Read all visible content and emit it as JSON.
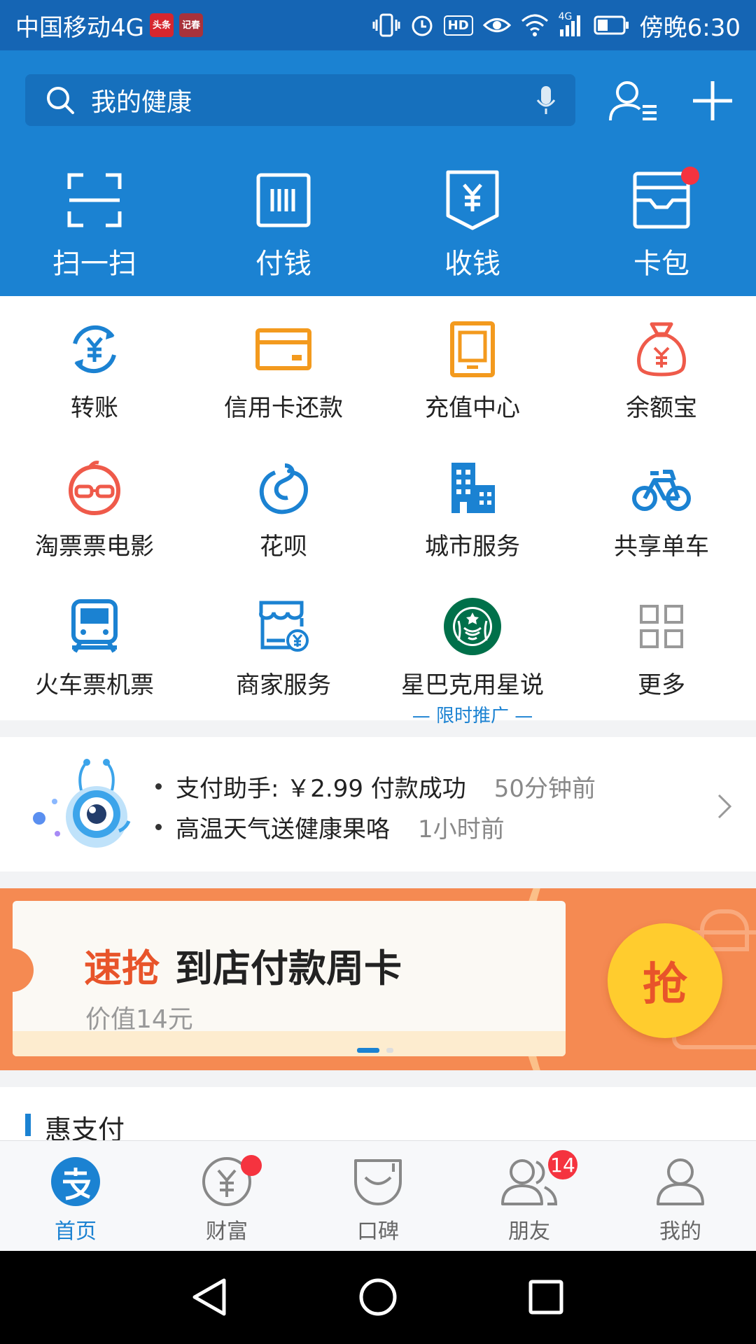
{
  "status_bar": {
    "carrier": "中国移动4G",
    "badge1": "头条",
    "badge2": "记春",
    "hd": "HD",
    "network": "4G",
    "time": "傍晚6:30"
  },
  "header": {
    "search_placeholder": "我的健康",
    "quick_actions": [
      {
        "label": "扫一扫",
        "icon": "scan-icon"
      },
      {
        "label": "付钱",
        "icon": "pay-barcode-icon"
      },
      {
        "label": "收钱",
        "icon": "receive-money-icon"
      },
      {
        "label": "卡包",
        "icon": "card-wallet-icon"
      }
    ]
  },
  "apps": [
    {
      "label": "转账",
      "icon": "transfer-icon",
      "color": "#1b82d2"
    },
    {
      "label": "信用卡还款",
      "icon": "credit-card-icon",
      "color": "#f39a1e"
    },
    {
      "label": "充值中心",
      "icon": "phone-recharge-icon",
      "color": "#f39a1e"
    },
    {
      "label": "余额宝",
      "icon": "money-bag-icon",
      "color": "#ef5a4a"
    },
    {
      "label": "淘票票电影",
      "icon": "movie-mascot-icon",
      "color": "#ef5a4a"
    },
    {
      "label": "花呗",
      "icon": "huabei-icon",
      "color": "#1b82d2"
    },
    {
      "label": "城市服务",
      "icon": "city-building-icon",
      "color": "#1b82d2"
    },
    {
      "label": "共享单车",
      "icon": "bicycle-icon",
      "color": "#1b82d2"
    },
    {
      "label": "火车票机票",
      "icon": "train-icon",
      "color": "#1b82d2"
    },
    {
      "label": "商家服务",
      "icon": "shop-icon",
      "color": "#1b82d2"
    },
    {
      "label": "星巴克用星说",
      "icon": "starbucks-icon",
      "color": "#00704a",
      "sub": "— 限时推广 —"
    },
    {
      "label": "更多",
      "icon": "more-grid-icon",
      "color": "#999999"
    }
  ],
  "notice": {
    "line1_text": "支付助手: ￥2.99 付款成功",
    "line1_time": "50分钟前",
    "line2_text": "高温天气送健康果咯",
    "line2_time": "1小时前"
  },
  "banner": {
    "highlight": "速抢",
    "title": "到店付款周卡",
    "subtitle": "价值14元",
    "button": "抢"
  },
  "section": {
    "title": "惠支付"
  },
  "tabs": [
    {
      "label": "首页",
      "icon": "alipay-home-icon"
    },
    {
      "label": "财富",
      "icon": "wealth-icon"
    },
    {
      "label": "口碑",
      "icon": "koubei-icon"
    },
    {
      "label": "朋友",
      "icon": "friends-icon",
      "badge": "14"
    },
    {
      "label": "我的",
      "icon": "profile-icon"
    }
  ]
}
